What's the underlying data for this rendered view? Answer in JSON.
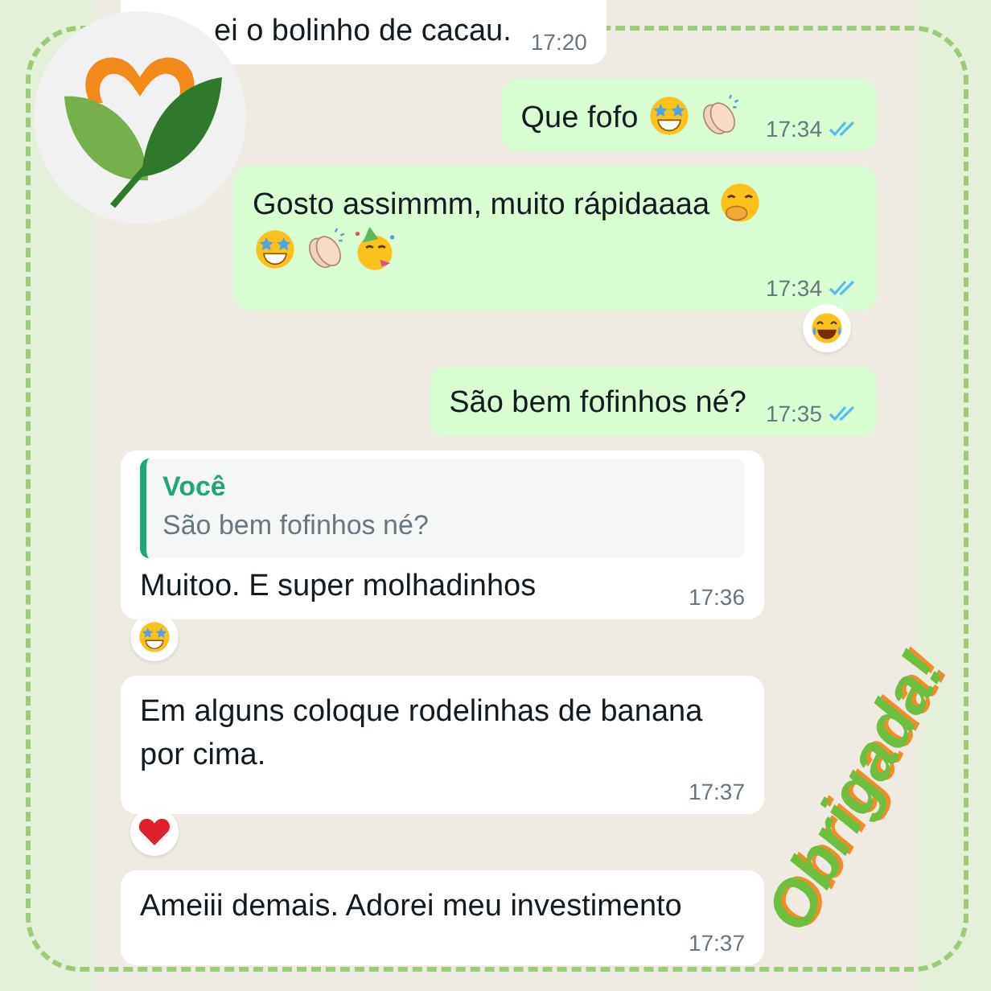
{
  "messages": [
    {
      "kind": "incoming",
      "text": "ei o bolinho de cacau.",
      "time": "17:20"
    },
    {
      "kind": "outgoing",
      "text": "Que fofo",
      "emoji_lines": [
        [
          {
            "kind": "star_struck"
          },
          {
            "kind": "clap"
          }
        ]
      ],
      "time": "17:34",
      "read": true
    },
    {
      "kind": "outgoing",
      "text": "Gosto assimmm, muito rápidaaaa",
      "emoji_lines": [
        [
          {
            "kind": "hand_over_mouth"
          }
        ],
        [
          {
            "kind": "star_struck"
          },
          {
            "kind": "clap"
          },
          {
            "kind": "party"
          }
        ]
      ],
      "time": "17:34",
      "read": true,
      "reaction": {
        "kind": "laughing"
      }
    },
    {
      "kind": "outgoing",
      "text": "São bem fofinhos né?",
      "time": "17:35",
      "read": true
    },
    {
      "kind": "incoming",
      "quote": {
        "author": "Você",
        "text": "São bem fofinhos né?"
      },
      "text": "Muitoo. E super molhadinhos",
      "time": "17:36",
      "reaction": {
        "kind": "star_struck"
      }
    },
    {
      "kind": "incoming",
      "text": "Em alguns coloque rodelinhas de banana por cima.",
      "time": "17:37",
      "reaction": {
        "kind": "heart"
      }
    },
    {
      "kind": "incoming",
      "text": "Ameiii demais. Adorei meu investimento",
      "time": "17:37"
    }
  ],
  "overlay_text": "Obrigada!"
}
